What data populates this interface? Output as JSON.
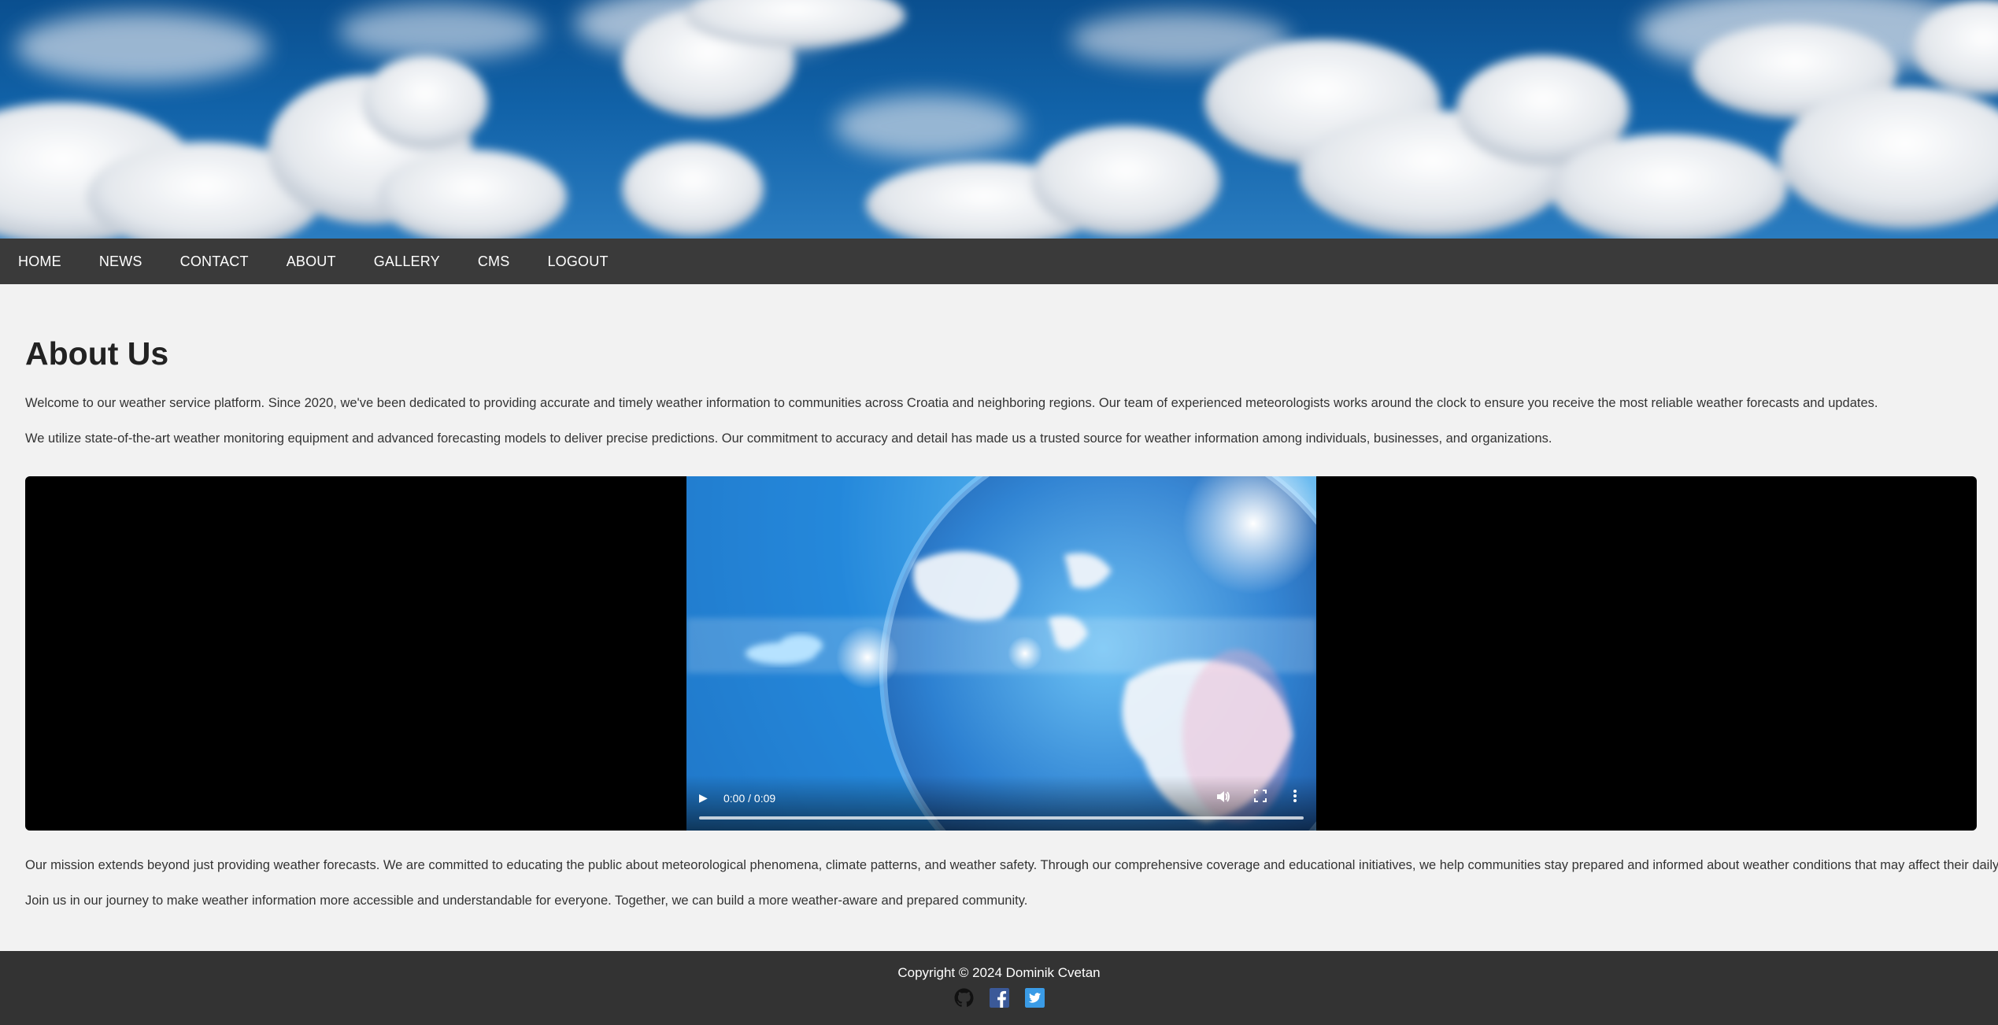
{
  "nav": {
    "items": [
      {
        "label": "HOME"
      },
      {
        "label": "NEWS"
      },
      {
        "label": "CONTACT"
      },
      {
        "label": "ABOUT"
      },
      {
        "label": "GALLERY"
      },
      {
        "label": "CMS"
      },
      {
        "label": "LOGOUT"
      }
    ]
  },
  "main": {
    "title": "About Us",
    "paragraphs": [
      "Welcome to our weather service platform. Since 2020, we've been dedicated to providing accurate and timely weather information to communities across Croatia and neighboring regions. Our team of experienced meteorologists works around the clock to ensure you receive the most reliable weather forecasts and updates.",
      "We utilize state-of-the-art weather monitoring equipment and advanced forecasting models to deliver precise predictions. Our commitment to accuracy and detail has made us a trusted source for weather information among individuals, businesses, and organizations.",
      "Our mission extends beyond just providing weather forecasts. We are committed to educating the public about meteorological phenomena, climate patterns, and weather safety. Through our comprehensive coverage and educational initiatives, we help communities stay prepared and informed about weather conditions that may affect their daily lives.",
      "Join us in our journey to make weather information more accessible and understandable for everyone. Together, we can build a more weather-aware and prepared community."
    ],
    "video": {
      "time": "0:00 / 0:09",
      "progress": 0
    }
  },
  "footer": {
    "copyright": "Copyright © 2024 Dominik Cvetan",
    "social": [
      {
        "icon": "github-icon"
      },
      {
        "icon": "facebook-icon"
      },
      {
        "icon": "twitter-icon"
      }
    ]
  },
  "colors": {
    "nav_bg": "#3a3a3a",
    "page_bg": "#f2f2f2",
    "footer_bg": "#333333"
  }
}
